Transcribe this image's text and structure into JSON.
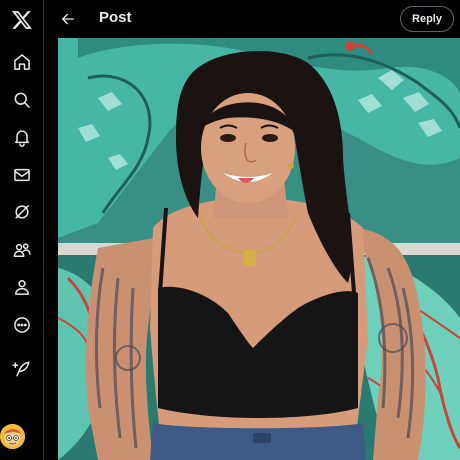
{
  "nav": {
    "items": [
      {
        "name": "home",
        "icon": "home-icon"
      },
      {
        "name": "explore",
        "icon": "search-icon"
      },
      {
        "name": "notifications",
        "icon": "bell-icon"
      },
      {
        "name": "messages",
        "icon": "mail-icon"
      },
      {
        "name": "grok",
        "icon": "slash-circle-icon"
      },
      {
        "name": "communities",
        "icon": "people-icon"
      },
      {
        "name": "profile",
        "icon": "person-icon"
      },
      {
        "name": "more",
        "icon": "more-circle-icon"
      },
      {
        "name": "post",
        "icon": "feather-plus-icon"
      }
    ],
    "logo_icon": "x-logo-icon",
    "avatar_icon": "user-avatar"
  },
  "header": {
    "back_icon": "arrow-left-icon",
    "title": "Post",
    "reply_label": "Reply"
  },
  "media": {
    "kind": "photo",
    "colors": {
      "mural_teal": "#3fb3a4",
      "mural_light": "#9fe0d2",
      "mural_red": "#c8453b",
      "top_black": "#151515",
      "skin": "#d9a080",
      "hair": "#1a1311",
      "denim": "#3e5a86"
    }
  },
  "colors": {
    "background": "#000000",
    "text": "#e7e9ea",
    "border": "#2f3336",
    "reply_border": "#536471"
  }
}
